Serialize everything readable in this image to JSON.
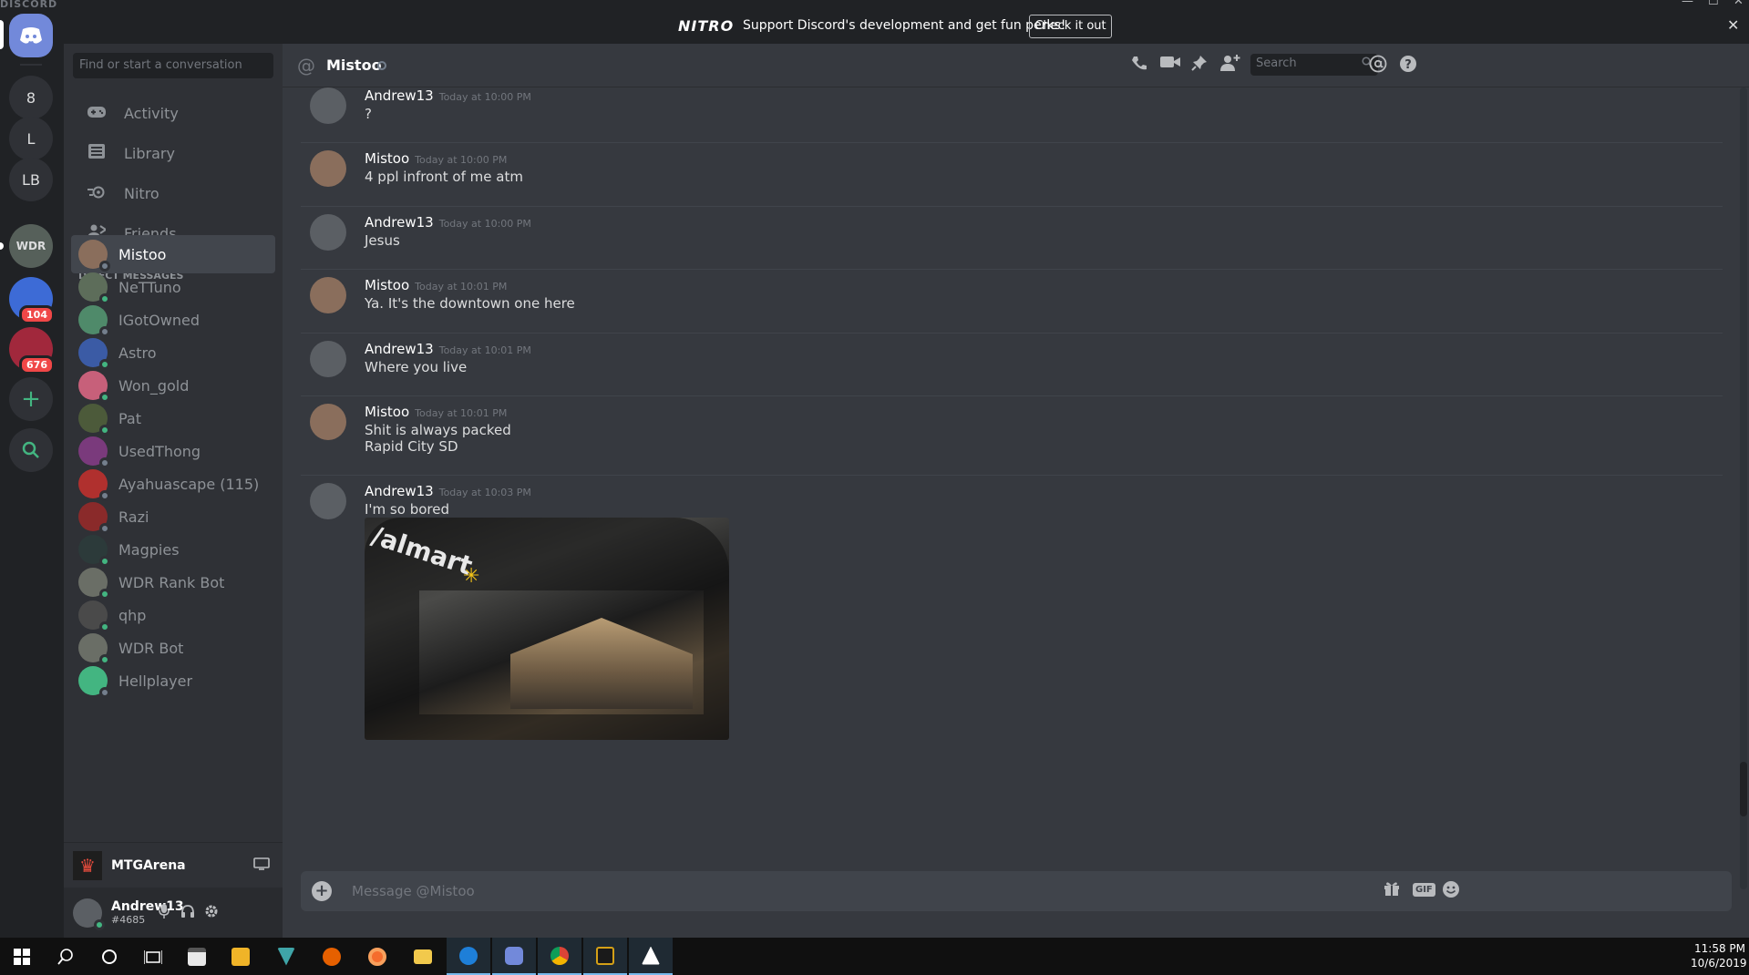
{
  "window": {
    "wordmark": "DISCORD",
    "minimize": "—",
    "maximize": "☐",
    "close": "✕"
  },
  "nitro_banner": {
    "logo": "NITRO",
    "text": "Support Discord's development and get fun perks!",
    "button": "Check it out",
    "close": "✕"
  },
  "servers": [
    {
      "label": "8"
    },
    {
      "label": "L"
    },
    {
      "label": "LB"
    },
    {
      "label": "WDR"
    },
    {
      "label": "",
      "badge": "104",
      "color": "#3d6bd6"
    },
    {
      "label": "",
      "badge": "676",
      "color": "#a1283c"
    }
  ],
  "server_actions": {
    "add": "+",
    "explore": "⌕"
  },
  "sidebar": {
    "search_placeholder": "Find or start a conversation",
    "nav": [
      {
        "label": "Activity",
        "icon": "gamepad-icon"
      },
      {
        "label": "Library",
        "icon": "library-icon"
      },
      {
        "label": "Nitro",
        "icon": "nitro-icon"
      },
      {
        "label": "Friends",
        "icon": "friends-icon"
      }
    ],
    "dm_header": "DIRECT MESSAGES",
    "dms": [
      {
        "name": "Mistoo",
        "online": false,
        "color": "#8a6e5c",
        "active": true
      },
      {
        "name": "NeTTuno",
        "online": true,
        "color": "#5d6d5a"
      },
      {
        "name": "IGotOwned",
        "online": false,
        "color": "#4f8a6a"
      },
      {
        "name": "Astro",
        "online": true,
        "color": "#3b5ba5"
      },
      {
        "name": "Won_gold",
        "online": true,
        "color": "#c7607a"
      },
      {
        "name": "Pat",
        "online": true,
        "color": "#4c5a3a"
      },
      {
        "name": "UsedThong",
        "online": false,
        "color": "#7a3a7c"
      },
      {
        "name": "Ayahuascape (115)",
        "online": false,
        "color": "#b0302e"
      },
      {
        "name": "Razi",
        "online": false,
        "color": "#8a2a2a"
      },
      {
        "name": "Magpies",
        "online": true,
        "color": "#2c3a3a"
      },
      {
        "name": "WDR Rank Bot",
        "online": true,
        "color": "#6a6e66"
      },
      {
        "name": "qhp",
        "online": true,
        "color": "#4a4a4a"
      },
      {
        "name": "WDR Bot",
        "online": true,
        "color": "#6a6e66"
      },
      {
        "name": "Hellplayer",
        "online": false,
        "color": "#43b581"
      }
    ],
    "now_playing": "MTGArena",
    "user": {
      "name": "Andrew13",
      "tag": "#4685"
    }
  },
  "chat": {
    "title": "Mistoo",
    "search_placeholder": "Search",
    "composer_placeholder": "Message @Mistoo",
    "messages": [
      {
        "author": "Andrew13",
        "time": "Today at 10:00 PM",
        "lines": [
          "?"
        ]
      },
      {
        "author": "Mistoo",
        "time": "Today at 10:00 PM",
        "lines": [
          "4 ppl infront of me atm"
        ]
      },
      {
        "author": "Andrew13",
        "time": "Today at 10:00 PM",
        "lines": [
          "Jesus"
        ]
      },
      {
        "author": "Mistoo",
        "time": "Today at 10:01 PM",
        "lines": [
          "Ya. It's the downtown one here"
        ]
      },
      {
        "author": "Andrew13",
        "time": "Today at 10:01 PM",
        "lines": [
          "Where you live"
        ]
      },
      {
        "author": "Mistoo",
        "time": "Today at 10:01 PM",
        "lines": [
          "Shit is always packed",
          "Rapid City SD"
        ]
      },
      {
        "author": "Andrew13",
        "time": "Today at 10:03 PM",
        "lines": [
          "I'm so bored"
        ],
        "attachment_text": "/almart"
      }
    ]
  },
  "taskbar": {
    "time": "11:58 PM",
    "date": "10/6/2019"
  }
}
